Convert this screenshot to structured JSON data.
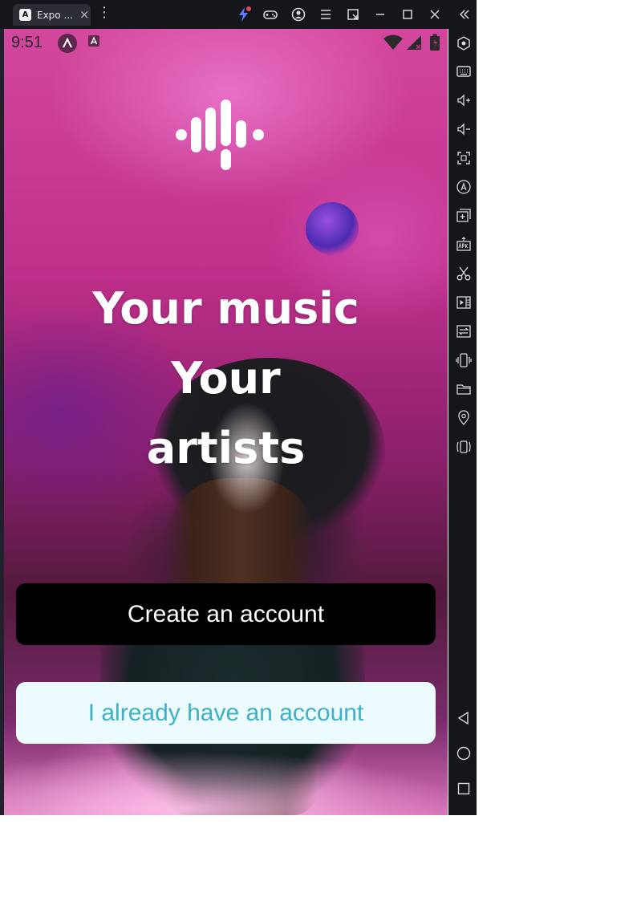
{
  "window": {
    "tab_title": "Expo ...",
    "tab_favicon_letter": "A",
    "tab_close": "×",
    "menu_glyph": "⋮"
  },
  "status_bar": {
    "time": "9:51"
  },
  "hero": {
    "headline_lines": [
      "Your music",
      "Your",
      "artists"
    ]
  },
  "actions": {
    "create_account_label": "Create an account",
    "login_label": "I already have an account"
  },
  "colors": {
    "create_button_bg": "#000000",
    "create_button_text": "#ffffff",
    "login_button_bg": "#ecfcfe",
    "login_button_text": "#3fb0c4",
    "emulator_chrome": "#15161c",
    "accent_bolt": "#5b7cff",
    "notification_dot": "#e24a4a"
  },
  "icons": {
    "titlebar": [
      "lightning-icon",
      "gamepad-icon",
      "account-icon",
      "menu-icon",
      "resize-icon",
      "minimize-icon",
      "maximize-icon",
      "close-icon",
      "collapse-icon"
    ],
    "sidebar": [
      "hexagon-settings-icon",
      "keyboard-icon",
      "volume-up-icon",
      "volume-down-icon",
      "screenshot-icon",
      "rotate-icon",
      "add-window-icon",
      "apk-icon",
      "scissors-icon",
      "record-icon",
      "swap-icon",
      "shake-icon",
      "folder-icon",
      "location-icon",
      "vibrate-icon",
      "back-icon",
      "home-icon",
      "recents-icon"
    ],
    "logo": "podcast-waveform-icon"
  }
}
